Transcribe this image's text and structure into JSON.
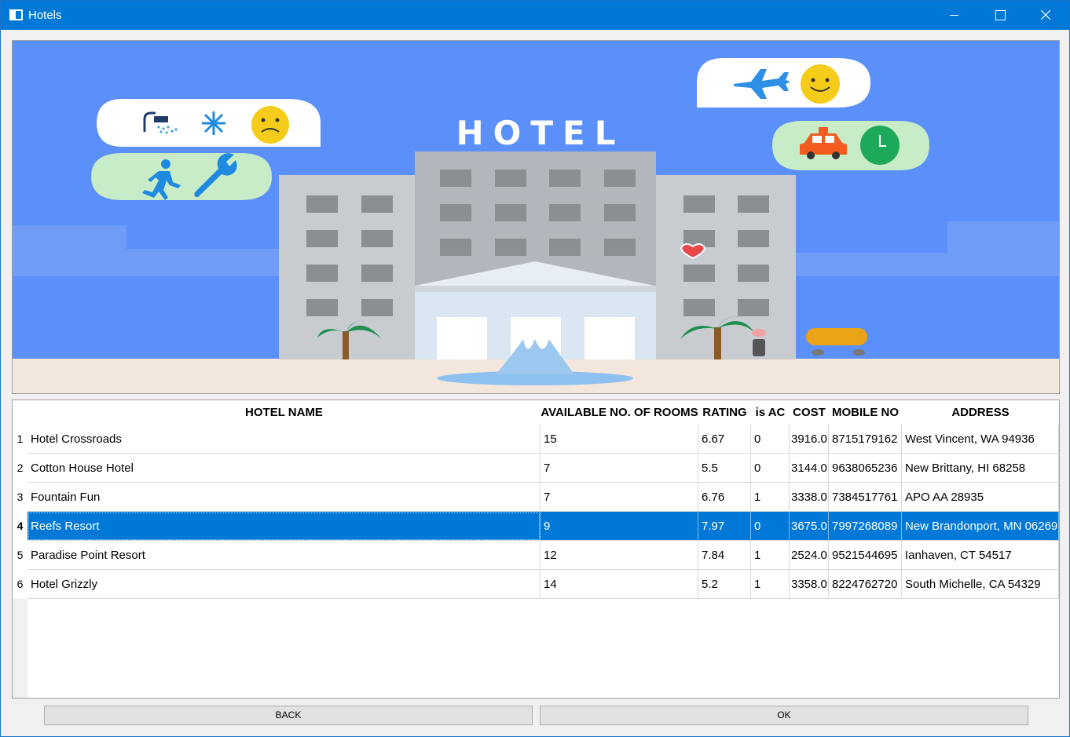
{
  "window": {
    "title": "Hotels"
  },
  "banner": {
    "sign_text": "HOTEL"
  },
  "table": {
    "columns": [
      "HOTEL NAME",
      "AVAILABLE NO. OF ROOMS",
      "RATING",
      "is AC",
      "COST",
      "MOBILE NO",
      "ADDRESS"
    ],
    "rows": [
      {
        "num": "1",
        "cells": [
          "Hotel Crossroads",
          "15",
          "6.67",
          "0",
          "3916.0",
          "8715179162",
          "West Vincent, WA 94936"
        ]
      },
      {
        "num": "2",
        "cells": [
          "Cotton House Hotel",
          "7",
          "5.5",
          "0",
          "3144.0",
          "9638065236",
          "New Brittany, HI 68258"
        ]
      },
      {
        "num": "3",
        "cells": [
          "Fountain Fun",
          "7",
          "6.76",
          "1",
          "3338.0",
          "7384517761",
          "APO AA 28935"
        ]
      },
      {
        "num": "4",
        "cells": [
          "Reefs Resort",
          "9",
          "7.97",
          "0",
          "3675.0",
          "7997268089",
          "New Brandonport, MN 06269"
        ]
      },
      {
        "num": "5",
        "cells": [
          "Paradise Point Resort",
          "12",
          "7.84",
          "1",
          "2524.0",
          "9521544695",
          "Ianhaven, CT 54517"
        ]
      },
      {
        "num": "6",
        "cells": [
          "Hotel Grizzly",
          "14",
          "5.2",
          "1",
          "3358.0",
          "8224762720",
          "South Michelle, CA 54329"
        ]
      }
    ],
    "selected_row": "4"
  },
  "buttons": {
    "back_label": "BACK",
    "ok_label": "OK"
  },
  "colors": {
    "titlebar": "#0078d7",
    "selection": "#0078d7",
    "sky": "#5b8ff9"
  }
}
